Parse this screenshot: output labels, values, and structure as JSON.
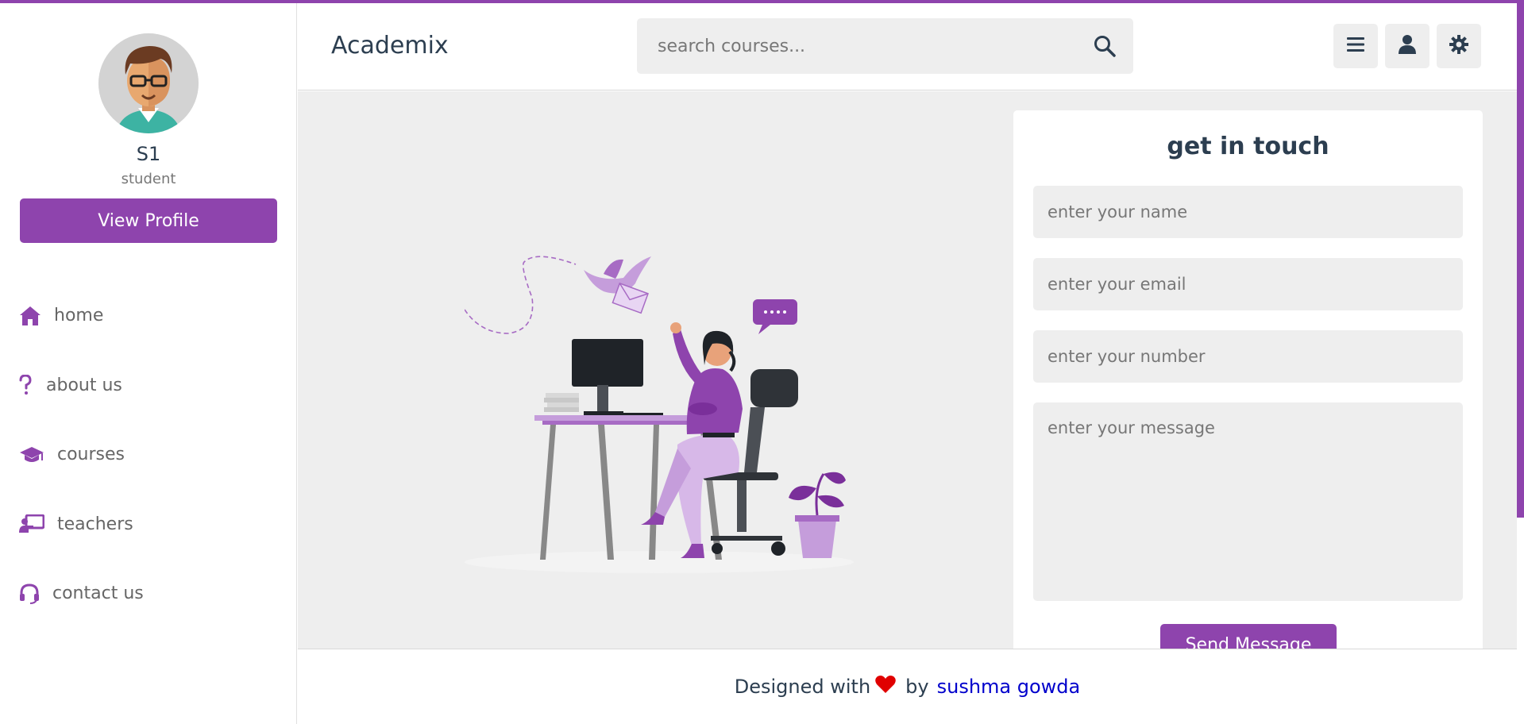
{
  "colors": {
    "accent": "#8e44ad",
    "background": "#eeeeee",
    "text": "#2c3e50"
  },
  "profile": {
    "name": "S1",
    "role": "student",
    "view_button": "View Profile"
  },
  "sidebar": {
    "items": [
      {
        "label": "home",
        "icon": "home-icon"
      },
      {
        "label": "about us",
        "icon": "question-icon"
      },
      {
        "label": "courses",
        "icon": "graduation-cap-icon"
      },
      {
        "label": "teachers",
        "icon": "chalkboard-teacher-icon"
      },
      {
        "label": "contact us",
        "icon": "headset-icon"
      }
    ]
  },
  "header": {
    "logo": "Academix",
    "search": {
      "placeholder": "search courses..."
    },
    "buttons": [
      "menu-icon",
      "user-icon",
      "settings-icon"
    ]
  },
  "contact": {
    "title": "get in touch",
    "name_placeholder": "enter your name",
    "email_placeholder": "enter your email",
    "number_placeholder": "enter your number",
    "message_placeholder": "enter your message",
    "send_label": "Send Message"
  },
  "footer": {
    "prefix": "Designed with",
    "by": "by",
    "author": "sushma gowda"
  }
}
